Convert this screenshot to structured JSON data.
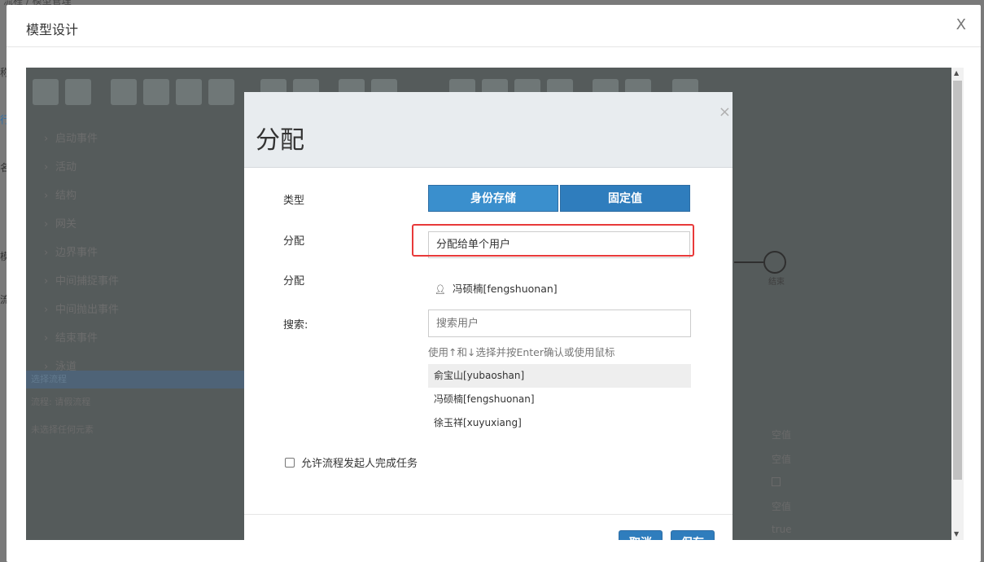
{
  "background": {
    "breadcrumb": "流程 / 模型管理",
    "side_fragments": [
      "称",
      "行",
      "名",
      "模",
      "流"
    ]
  },
  "outer_modal": {
    "title": "模型设计",
    "close_label": "X"
  },
  "designer": {
    "palette_items": [
      "启动事件",
      "活动",
      "结构",
      "网关",
      "边界事件",
      "中间捕捉事件",
      "中间抛出事件",
      "结束事件",
      "泳道"
    ],
    "palette_bar": "选择流程",
    "palette_lines": [
      "流程: 请假流程",
      "未选择任何元素"
    ],
    "end_event_label": "结束",
    "props": [
      "空值",
      "空值",
      "空值",
      "true"
    ]
  },
  "dialog": {
    "title": "分配",
    "close_label": "×",
    "type_label": "类型",
    "type_buttons": [
      "身份存储",
      "固定值"
    ],
    "assign_label": "分配",
    "assign_select_value": "分配给单个用户",
    "assignee_label": "分配",
    "assignee_value": "冯硕楠[fengshuonan]",
    "search_label": "搜索:",
    "search_placeholder": "搜索用户",
    "search_hint": "使用↑和↓选择并按Enter确认或使用鼠标",
    "users": [
      "俞宝山[yubaoshan]",
      "冯硕楠[fengshuonan]",
      "徐玉祥[xuyuxiang]"
    ],
    "active_user_index": 0,
    "allow_initiator_label": "允许流程发起人完成任务",
    "cancel_label": "取消",
    "save_label": "保存"
  },
  "colors": {
    "primary": "#2f7dbd",
    "highlight": "#e83a3a"
  }
}
